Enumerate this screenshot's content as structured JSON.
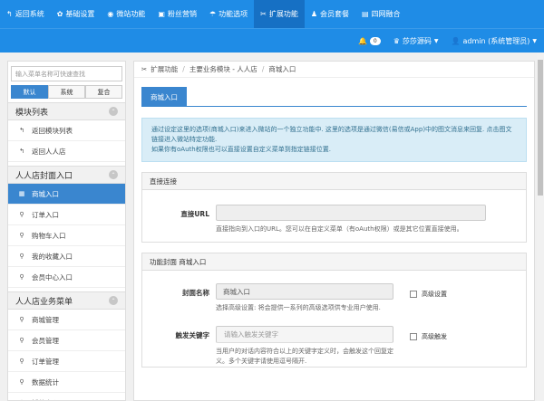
{
  "topnav": [
    {
      "icon": "↰",
      "icon_name": "back-icon",
      "label": "返回系统"
    },
    {
      "icon": "✿",
      "icon_name": "gear-icon",
      "label": "基础设置"
    },
    {
      "icon": "◉",
      "icon_name": "globe-icon",
      "label": "微站功能"
    },
    {
      "icon": "▣",
      "icon_name": "fans-icon",
      "label": "粉丝营销"
    },
    {
      "icon": "☂",
      "icon_name": "umbrella-icon",
      "label": "功能选项"
    },
    {
      "icon": "✂",
      "icon_name": "wrench-icon",
      "label": "扩展功能"
    },
    {
      "icon": "♟",
      "icon_name": "users-icon",
      "label": "会员套餐"
    },
    {
      "icon": "▤",
      "icon_name": "fusion-icon",
      "label": "四网融合"
    }
  ],
  "subbar": {
    "notify_count": "0",
    "site_name": "莎莎源码",
    "user": "admin (系统管理员)"
  },
  "sidebar": {
    "search_placeholder": "输入菜单名称可快速查找",
    "tabs": [
      "默认",
      "系统",
      "复合"
    ],
    "groups": [
      {
        "title": "模块列表",
        "items": [
          {
            "icon": "↰",
            "label": "返回模块列表"
          },
          {
            "icon": "↰",
            "label": "返回人人店"
          }
        ]
      },
      {
        "title": "人人店封面入口",
        "items": [
          {
            "icon": "▦",
            "label": "商城入口",
            "active": true
          },
          {
            "icon": "⚲",
            "label": "订单入口"
          },
          {
            "icon": "⚲",
            "label": "购物车入口"
          },
          {
            "icon": "⚲",
            "label": "我的收藏入口"
          },
          {
            "icon": "⚲",
            "label": "会员中心入口"
          }
        ]
      },
      {
        "title": "人人店业务菜单",
        "items": [
          {
            "icon": "⚲",
            "label": "商城管理"
          },
          {
            "icon": "⚲",
            "label": "会员管理"
          },
          {
            "icon": "⚲",
            "label": "订单管理"
          },
          {
            "icon": "⚲",
            "label": "数据统计"
          },
          {
            "icon": "⚲",
            "label": "插件中心"
          }
        ]
      }
    ]
  },
  "breadcrumb": [
    "扩展功能",
    "主要业务模块 - 人人店",
    "商城入口"
  ],
  "tab_label": "商城入口",
  "notice": [
    "通过设定这里的选项(商城入口)来进入微站的一个独立功能中. 这里的选项是通过微信(易信或App)中的图文消息来回复. 点击图文链接进入微站特定功能.",
    "如果你有oAuth权限也可以直接设置自定义菜单到指定链接位置."
  ],
  "direct_panel": {
    "title": "直接连接",
    "url_label": "直接URL",
    "url_value": "",
    "url_help": "直接指向到入口的URL。您可以在自定义菜单（有oAuth权限）或是其它位置直接使用。"
  },
  "cover_panel": {
    "title_main": "功能封面",
    "title_sub": "商城入口",
    "name_label": "封面名称",
    "name_value": "商城入口",
    "name_adv": "高级设置",
    "name_help": "选择高级设置: 将会提供一系列的高级选项供专业用户使用.",
    "kw_label": "触发关键字",
    "kw_placeholder": "请输入触发关键字",
    "kw_adv": "高级触发",
    "kw_help": "当用户的对话内容符合以上的关键字定义时，会触发这个回复定义。多个关键字请使用逗号隔开."
  }
}
